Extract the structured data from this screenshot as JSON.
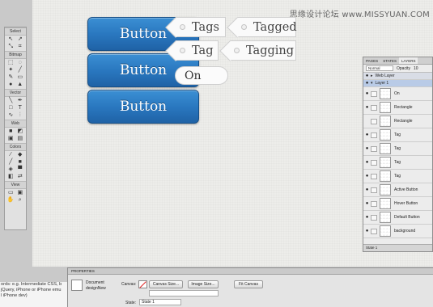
{
  "watermark": "思缘设计论坛 www.MISSYUAN.COM",
  "buttons": [
    {
      "label": "Button"
    },
    {
      "label": "Button"
    },
    {
      "label": "Button"
    }
  ],
  "tags": [
    {
      "label": "Tags"
    },
    {
      "label": "Tagged"
    },
    {
      "label": "Tag"
    },
    {
      "label": "Tagging"
    }
  ],
  "toggle": {
    "label": "On"
  },
  "tools": {
    "sections": [
      "Select",
      "Bitmap",
      "Vector",
      "Web",
      "Colors",
      "View"
    ]
  },
  "layers": {
    "tabs": [
      "PAGES",
      "STATES",
      "LAYERS"
    ],
    "blend": "Normal",
    "opacity_label": "Opacity",
    "opacity_value": "10",
    "rows": [
      {
        "name": "Web Layer",
        "type": "folder"
      },
      {
        "name": "Layer 1",
        "type": "folder-selected"
      },
      {
        "name": "On",
        "type": "layer"
      },
      {
        "name": "Rectangle",
        "type": "layer"
      },
      {
        "name": "Rectangle",
        "type": "layer"
      },
      {
        "name": "Tag",
        "type": "layer"
      },
      {
        "name": "Tag",
        "type": "layer"
      },
      {
        "name": "Tag",
        "type": "layer"
      },
      {
        "name": "Tag",
        "type": "layer"
      },
      {
        "name": "Active Button",
        "type": "layer"
      },
      {
        "name": "Hover Button",
        "type": "layer"
      },
      {
        "name": "Default Button",
        "type": "layer"
      },
      {
        "name": "background",
        "type": "layer"
      }
    ],
    "footer": "State 1"
  },
  "properties": {
    "header": "PROPERTIES",
    "doc_label": "Document",
    "doc_name": "designNew",
    "canvas_label": "Canvas:",
    "canvas_size_btn": "Canvas Size...",
    "image_size_btn": "Image Size...",
    "fit_canvas_btn": "Fit Canvas",
    "state_label": "State:",
    "state_value": "State 1"
  },
  "code_snippet": {
    "lines": [
      "ords: e.g. Intermediate CSS, b",
      "jQuery, iPhone or iPhone emu",
      "l iPhone dev)"
    ]
  }
}
